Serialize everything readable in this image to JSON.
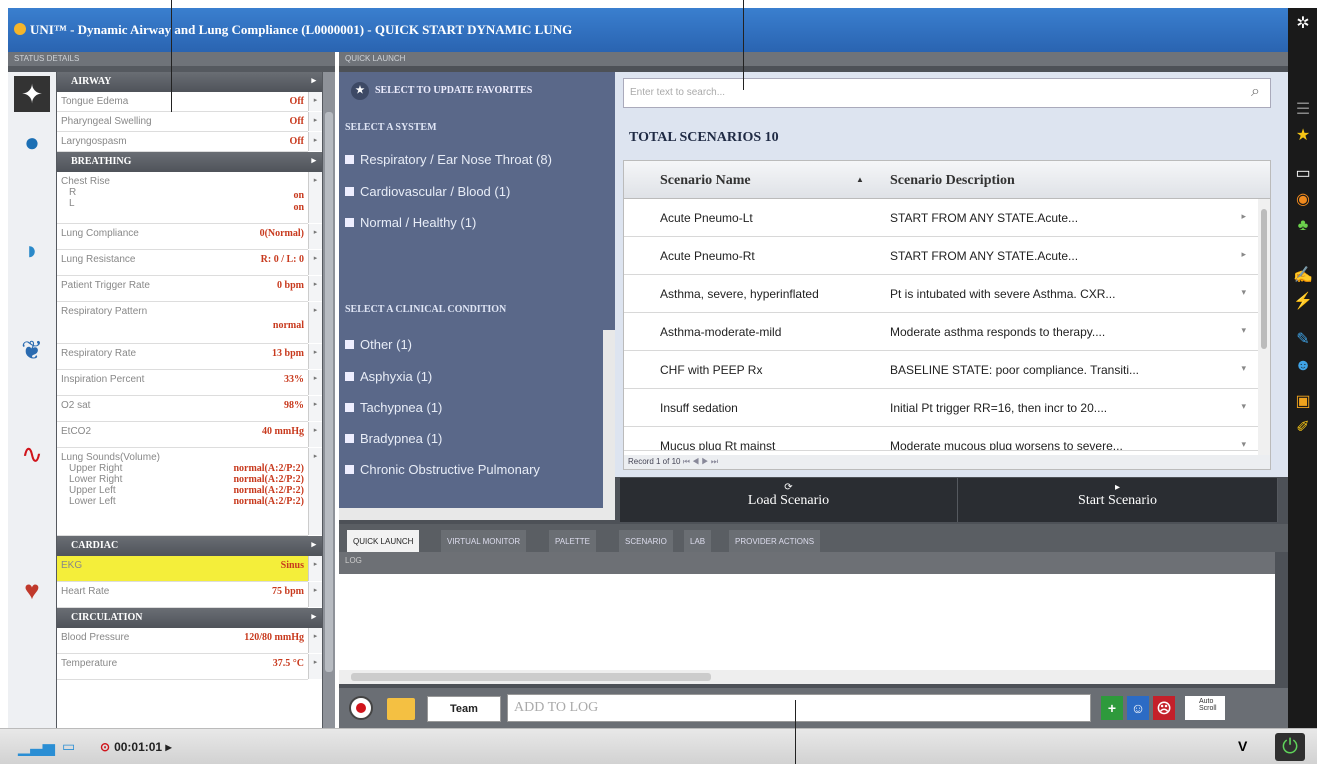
{
  "window_title": "UNI™ - Dynamic Airway and Lung Compliance (L0000001) - QUICK START DYNAMIC LUNG",
  "left_panel": {
    "header": "STATUS DETAILS",
    "sections": {
      "airway": "AIRWAY",
      "breathing": "BREATHING",
      "cardiac": "CARDIAC",
      "circulation": "CIRCULATION"
    },
    "airway": [
      {
        "label": "Tongue Edema",
        "value": "Off"
      },
      {
        "label": "Pharyngeal Swelling",
        "value": "Off"
      },
      {
        "label": "Laryngospasm",
        "value": "Off"
      }
    ],
    "chest_rise": {
      "label": "Chest Rise",
      "r_label": "R",
      "l_label": "L",
      "r_value": "on",
      "l_value": "on"
    },
    "breathing": [
      {
        "label": "Lung Compliance",
        "value": "0(Normal)"
      },
      {
        "label": "Lung Resistance",
        "value": "R: 0 / L: 0"
      },
      {
        "label": "Patient Trigger Rate",
        "value": "0 bpm"
      }
    ],
    "resp_pattern": {
      "label": "Respiratory Pattern",
      "value": "normal"
    },
    "breathing2": [
      {
        "label": "Respiratory Rate",
        "value": "13 bpm"
      },
      {
        "label": "Inspiration Percent",
        "value": "33%"
      },
      {
        "label": "O2 sat",
        "value": "98%"
      },
      {
        "label": "EtCO2",
        "value": "40 mmHg"
      }
    ],
    "lung_sounds": {
      "label": "Lung Sounds(Volume)",
      "items": [
        {
          "label": "Upper Right",
          "value": "normal(A:2/P:2)"
        },
        {
          "label": "Lower Right",
          "value": "normal(A:2/P:2)"
        },
        {
          "label": "Upper Left",
          "value": "normal(A:2/P:2)"
        },
        {
          "label": "Lower Left",
          "value": "normal(A:2/P:2)"
        }
      ]
    },
    "cardiac": [
      {
        "label": "EKG",
        "value": "Sinus"
      },
      {
        "label": "Heart Rate",
        "value": "75 bpm"
      }
    ],
    "circulation": [
      {
        "label": "Blood Pressure",
        "value": "120/80 mmHg"
      },
      {
        "label": "Temperature",
        "value": "37.5 °C"
      }
    ]
  },
  "quick_launch": {
    "header": "QUICK LAUNCH",
    "favorites": "SELECT TO UPDATE FAVORITES",
    "select_system": "SELECT A SYSTEM",
    "systems": [
      "Respiratory / Ear Nose Throat (8)",
      "Cardiovascular / Blood (1)",
      "Normal / Healthy (1)"
    ],
    "select_condition": "SELECT A CLINICAL CONDITION",
    "conditions": [
      "Other (1)",
      "Asphyxia (1)",
      "Tachypnea (1)",
      "Bradypnea (1)",
      "Chronic Obstructive Pulmonary"
    ],
    "search_placeholder": "Enter text to search...",
    "total": "TOTAL SCENARIOS 10",
    "col_name": "Scenario Name",
    "col_desc": "Scenario Description",
    "scenarios": [
      {
        "name": "Acute Pneumo-Lt",
        "desc": "START FROM ANY STATE.Acute..."
      },
      {
        "name": "Acute Pneumo-Rt",
        "desc": "START FROM ANY STATE.Acute..."
      },
      {
        "name": "Asthma, severe, hyperinflated",
        "desc": "Pt is intubated with severe Asthma. CXR..."
      },
      {
        "name": "Asthma-moderate-mild",
        "desc": "Moderate asthma responds to therapy...."
      },
      {
        "name": "CHF with PEEP Rx",
        "desc": "BASELINE STATE: poor compliance. Transiti..."
      },
      {
        "name": "Insuff sedation",
        "desc": "Initial Pt trigger RR=16, then incr to 20...."
      },
      {
        "name": "Mucus plug Rt mainst",
        "desc": "Moderate mucous plug worsens to severe..."
      }
    ],
    "record_text": "Record 1 of 10",
    "load_button": "Load Scenario",
    "start_button": "Start Scenario"
  },
  "tabs": [
    "QUICK LAUNCH",
    "VIRTUAL MONITOR",
    "PALETTE",
    "SCENARIO",
    "LAB",
    "PROVIDER ACTIONS"
  ],
  "log": {
    "header": "LOG",
    "team_button": "Team",
    "add_placeholder": "ADD TO LOG",
    "auto_scroll": "Auto Scroll"
  },
  "status_bar": {
    "timer": "00:01:01",
    "version_label": "V"
  },
  "colors": {
    "accent_blue": "#2f6fc2",
    "value_red": "#c83a1e",
    "highlight_yellow": "#f4ee3a"
  }
}
